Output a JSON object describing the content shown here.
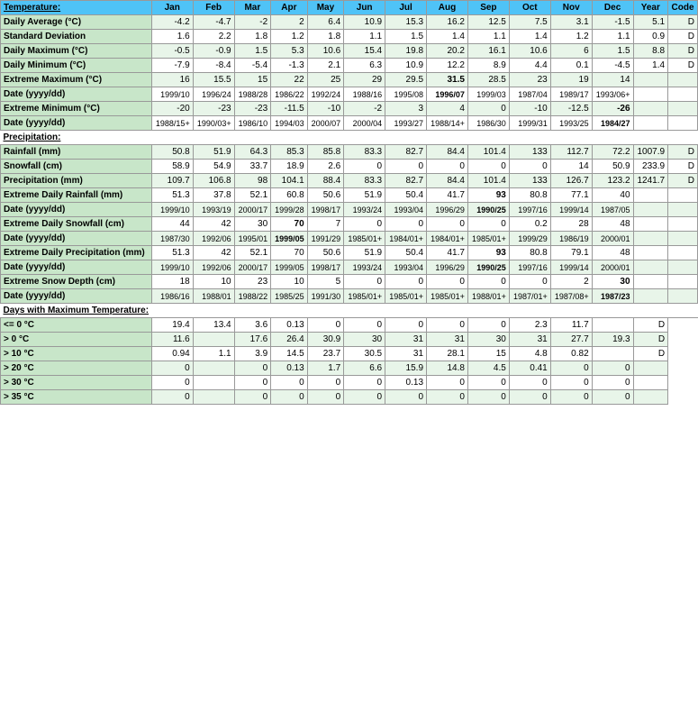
{
  "headers": [
    "Temperature:",
    "Jan",
    "Feb",
    "Mar",
    "Apr",
    "May",
    "Jun",
    "Jul",
    "Aug",
    "Sep",
    "Oct",
    "Nov",
    "Dec",
    "Year",
    "Code"
  ],
  "rows": [
    {
      "label": "Daily Average (°C)",
      "values": [
        "-4.2",
        "-4.7",
        "-2",
        "2",
        "6.4",
        "10.9",
        "15.3",
        "16.2",
        "12.5",
        "7.5",
        "3.1",
        "-1.5",
        "5.1",
        "D"
      ],
      "bold_cols": [],
      "bg": "light"
    },
    {
      "label": "Standard Deviation",
      "values": [
        "1.6",
        "2.2",
        "1.8",
        "1.2",
        "1.8",
        "1.1",
        "1.5",
        "1.4",
        "1.1",
        "1.4",
        "1.2",
        "1.1",
        "0.9",
        "D"
      ],
      "bold_cols": [],
      "bg": "white"
    },
    {
      "label": "Daily Maximum (°C)",
      "values": [
        "-0.5",
        "-0.9",
        "1.5",
        "5.3",
        "10.6",
        "15.4",
        "19.8",
        "20.2",
        "16.1",
        "10.6",
        "6",
        "1.5",
        "8.8",
        "D"
      ],
      "bold_cols": [],
      "bg": "light"
    },
    {
      "label": "Daily Minimum (°C)",
      "values": [
        "-7.9",
        "-8.4",
        "-5.4",
        "-1.3",
        "2.1",
        "6.3",
        "10.9",
        "12.2",
        "8.9",
        "4.4",
        "0.1",
        "-4.5",
        "1.4",
        "D"
      ],
      "bold_cols": [],
      "bg": "white"
    },
    {
      "label": "Extreme Maximum (°C)",
      "values": [
        "16",
        "15.5",
        "15",
        "22",
        "25",
        "29",
        "29.5",
        "31.5",
        "28.5",
        "23",
        "19",
        "14",
        "",
        ""
      ],
      "bold_cols": [
        7
      ],
      "bg": "light"
    },
    {
      "label": "Date (yyyy/dd)",
      "values": [
        "1999/10",
        "1996/24",
        "1988/28",
        "1986/22",
        "1992/24",
        "1988/16",
        "1995/08",
        "1996/07",
        "1999/03",
        "1987/04",
        "1989/17",
        "1993/06+",
        "",
        ""
      ],
      "bold_cols": [
        7
      ],
      "bg": "white",
      "is_date": true
    },
    {
      "label": "Extreme Minimum (°C)",
      "values": [
        "-20",
        "-23",
        "-23",
        "-11.5",
        "-10",
        "-2",
        "3",
        "4",
        "0",
        "-10",
        "-12.5",
        "-26",
        "",
        ""
      ],
      "bold_cols": [
        11
      ],
      "bg": "light"
    },
    {
      "label": "Date (yyyy/dd)",
      "values": [
        "1988/15+",
        "1990/03+",
        "1986/10",
        "1994/03",
        "2000/07",
        "2000/04",
        "1993/27",
        "1988/14+",
        "1986/30",
        "1999/31",
        "1993/25",
        "1984/27",
        "",
        ""
      ],
      "bold_cols": [
        11
      ],
      "bg": "white",
      "is_date": true
    }
  ],
  "precip_rows": [
    {
      "label": "Rainfall (mm)",
      "values": [
        "50.8",
        "51.9",
        "64.3",
        "85.3",
        "85.8",
        "83.3",
        "82.7",
        "84.4",
        "101.4",
        "133",
        "112.7",
        "72.2",
        "1007.9",
        "D"
      ],
      "bold_cols": [],
      "bg": "light"
    },
    {
      "label": "Snowfall (cm)",
      "values": [
        "58.9",
        "54.9",
        "33.7",
        "18.9",
        "2.6",
        "0",
        "0",
        "0",
        "0",
        "0",
        "14",
        "50.9",
        "233.9",
        "D"
      ],
      "bold_cols": [],
      "bg": "white"
    },
    {
      "label": "Precipitation (mm)",
      "values": [
        "109.7",
        "106.8",
        "98",
        "104.1",
        "88.4",
        "83.3",
        "82.7",
        "84.4",
        "101.4",
        "133",
        "126.7",
        "123.2",
        "1241.7",
        "D"
      ],
      "bold_cols": [],
      "bg": "light"
    },
    {
      "label": "Extreme Daily Rainfall (mm)",
      "values": [
        "51.3",
        "37.8",
        "52.1",
        "60.8",
        "50.6",
        "51.9",
        "50.4",
        "41.7",
        "93",
        "80.8",
        "77.1",
        "40",
        "",
        ""
      ],
      "bold_cols": [
        8
      ],
      "bg": "white"
    },
    {
      "label": "Date (yyyy/dd)",
      "values": [
        "1999/10",
        "1993/19",
        "2000/17",
        "1999/28",
        "1998/17",
        "1993/24",
        "1993/04",
        "1996/29",
        "1990/25",
        "1997/16",
        "1999/14",
        "1987/05",
        "",
        ""
      ],
      "bold_cols": [
        8
      ],
      "bg": "light",
      "is_date": true
    },
    {
      "label": "Extreme Daily Snowfall (cm)",
      "values": [
        "44",
        "42",
        "30",
        "70",
        "7",
        "0",
        "0",
        "0",
        "0",
        "0.2",
        "28",
        "48",
        "",
        ""
      ],
      "bold_cols": [
        3
      ],
      "bg": "white"
    },
    {
      "label": "Date (yyyy/dd)",
      "values": [
        "1987/30",
        "1992/06",
        "1995/01",
        "1999/05",
        "1991/29",
        "1985/01+",
        "1984/01+",
        "1984/01+",
        "1985/01+",
        "1999/29",
        "1986/19",
        "2000/01",
        "",
        ""
      ],
      "bold_cols": [
        3
      ],
      "bg": "light",
      "is_date": true
    },
    {
      "label": "Extreme Daily Precipitation (mm)",
      "values": [
        "51.3",
        "42",
        "52.1",
        "70",
        "50.6",
        "51.9",
        "50.4",
        "41.7",
        "93",
        "80.8",
        "79.1",
        "48",
        "",
        ""
      ],
      "bold_cols": [
        8
      ],
      "bg": "white"
    },
    {
      "label": "Date (yyyy/dd)",
      "values": [
        "1999/10",
        "1992/06",
        "2000/17",
        "1999/05",
        "1998/17",
        "1993/24",
        "1993/04",
        "1996/29",
        "1990/25",
        "1997/16",
        "1999/14",
        "2000/01",
        "",
        ""
      ],
      "bold_cols": [
        8
      ],
      "bg": "light",
      "is_date": true
    },
    {
      "label": "Extreme Snow Depth (cm)",
      "values": [
        "18",
        "10",
        "23",
        "10",
        "5",
        "0",
        "0",
        "0",
        "0",
        "0",
        "2",
        "30",
        "",
        ""
      ],
      "bold_cols": [
        11
      ],
      "bg": "white"
    },
    {
      "label": "Date (yyyy/dd)",
      "values": [
        "1986/16",
        "1988/01",
        "1988/22",
        "1985/25",
        "1991/30",
        "1985/01+",
        "1985/01+",
        "1985/01+",
        "1988/01+",
        "1987/01+",
        "1987/08+",
        "1987/23",
        "",
        ""
      ],
      "bold_cols": [
        11
      ],
      "bg": "light",
      "is_date": true
    }
  ],
  "days_rows": [
    {
      "label": "<= 0 °C",
      "values": [
        "19.4",
        "13.4",
        "3.6",
        "0.13",
        "0",
        "0",
        "0",
        "0",
        "0",
        "2.3",
        "11.7",
        "",
        "D"
      ],
      "bold_cols": [],
      "bg": "white"
    },
    {
      "label": "> 0 °C",
      "values": [
        "11.6",
        "",
        "17.6",
        "26.4",
        "30.9",
        "30",
        "31",
        "31",
        "30",
        "31",
        "27.7",
        "19.3",
        "D"
      ],
      "bold_cols": [],
      "bg": "light"
    },
    {
      "label": "> 10 °C",
      "values": [
        "0.94",
        "1.1",
        "3.9",
        "14.5",
        "23.7",
        "30.5",
        "31",
        "28.1",
        "15",
        "4.8",
        "0.82",
        "",
        "D"
      ],
      "bold_cols": [],
      "bg": "white"
    },
    {
      "label": "> 20 °C",
      "values": [
        "0",
        "",
        "0",
        "0.13",
        "1.7",
        "6.6",
        "15.9",
        "14.8",
        "4.5",
        "0.41",
        "0",
        "0",
        ""
      ],
      "bold_cols": [],
      "bg": "light"
    },
    {
      "label": "> 30 °C",
      "values": [
        "0",
        "",
        "0",
        "0",
        "0",
        "0",
        "0.13",
        "0",
        "0",
        "0",
        "0",
        "0",
        ""
      ],
      "bold_cols": [],
      "bg": "white"
    },
    {
      "label": "> 35 °C",
      "values": [
        "0",
        "",
        "0",
        "0",
        "0",
        "0",
        "0",
        "0",
        "0",
        "0",
        "0",
        "0",
        ""
      ],
      "bold_cols": [],
      "bg": "light"
    }
  ],
  "section_labels": {
    "temperature": "Temperature:",
    "precipitation": "Precipitation:",
    "days_max": "Days with Maximum Temperature:"
  },
  "extreme_daily_label": "Extreme Daily |"
}
